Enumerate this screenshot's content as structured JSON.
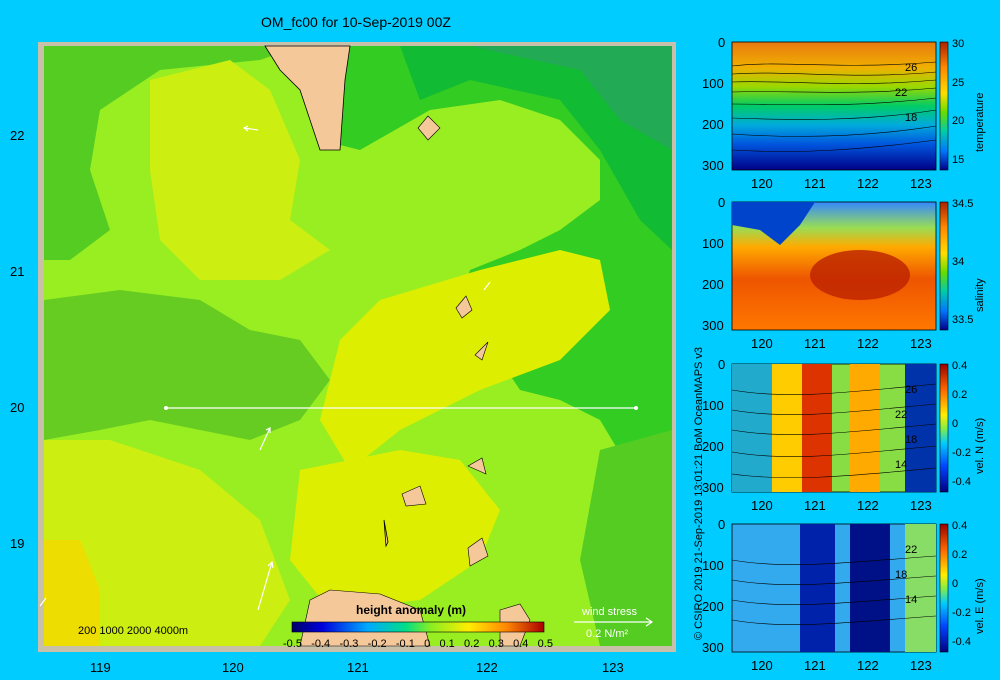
{
  "title": "OM_fc00 for 10-Sep-2019 00Z",
  "map": {
    "x_ticks": [
      "119",
      "120",
      "121",
      "122",
      "123"
    ],
    "y_ticks": [
      "22",
      "21",
      "20",
      "19"
    ],
    "depth_legend": "200  1000  2000  4000m",
    "colorbar": {
      "title": "height anomaly  (m)",
      "ticks": [
        "-0.5",
        "-0.4",
        "-0.3",
        "-0.2",
        "-0.1",
        "0",
        "0.1",
        "0.2",
        "0.3",
        "0.4",
        "0.5"
      ]
    },
    "wind_stress": {
      "label": "wind stress",
      "value": "0.2 N/m²"
    }
  },
  "credit": "© CSIRO 2019   21-Sep-2019 13:01:21  BoM OceanMAPS v3",
  "panels": [
    {
      "id": "temperature",
      "label": "temperature",
      "y_ticks": [
        "0",
        "100",
        "200",
        "300"
      ],
      "x_ticks": [
        "120",
        "121",
        "122",
        "123"
      ],
      "cbar_ticks": [
        "30",
        "25",
        "20",
        "15"
      ],
      "contour_labels": [
        "26",
        "22",
        "18"
      ]
    },
    {
      "id": "salinity",
      "label": "salinity",
      "y_ticks": [
        "0",
        "100",
        "200",
        "300"
      ],
      "x_ticks": [
        "120",
        "121",
        "122",
        "123"
      ],
      "cbar_ticks": [
        "34.5",
        "34",
        "33.5"
      ],
      "contour_labels": []
    },
    {
      "id": "vel-n",
      "label": "vel. N  (m/s)",
      "y_ticks": [
        "0",
        "100",
        "200",
        "300"
      ],
      "x_ticks": [
        "120",
        "121",
        "122",
        "123"
      ],
      "cbar_ticks": [
        "0.4",
        "0.2",
        "0",
        "-0.2",
        "-0.4"
      ],
      "contour_labels": [
        "26",
        "22",
        "18",
        "14"
      ]
    },
    {
      "id": "vel-e",
      "label": "vel. E  (m/s)",
      "y_ticks": [
        "0",
        "100",
        "200",
        "300"
      ],
      "x_ticks": [
        "120",
        "121",
        "122",
        "123"
      ],
      "cbar_ticks": [
        "0.4",
        "0.2",
        "0",
        "-0.2",
        "-0.4"
      ],
      "contour_labels": [
        "22",
        "18",
        "14"
      ]
    }
  ],
  "colors": {
    "background": "#00ccff",
    "land": "#f5c89a"
  }
}
